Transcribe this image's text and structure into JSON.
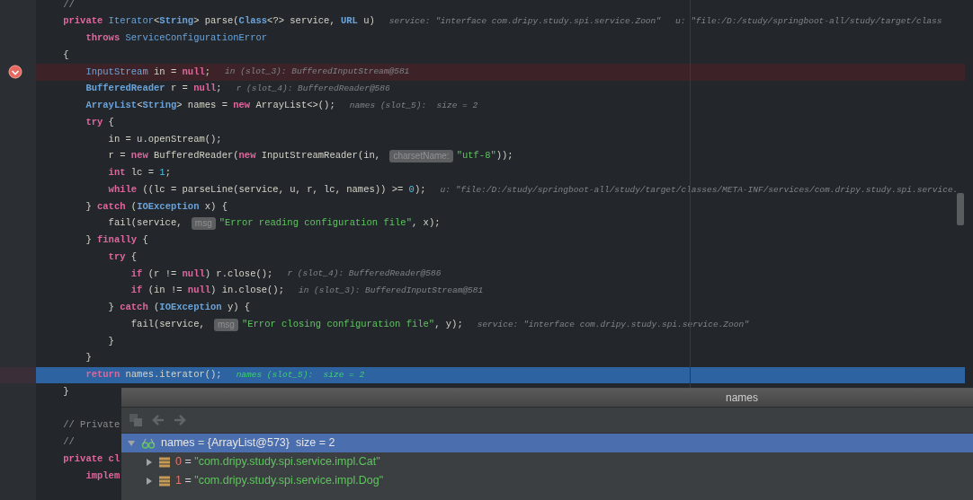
{
  "editor": {
    "lines": [
      {
        "breakpoint": false,
        "current": false,
        "tokens": [
          {
            "kind": "comment",
            "text": "    //"
          }
        ]
      },
      {
        "breakpoint": false,
        "current": false,
        "tokens": [
          {
            "kind": "kw",
            "text": "    private"
          },
          {
            "kind": "type_light",
            "text": " Iterator"
          },
          {
            "kind": "plain",
            "text": "<"
          },
          {
            "kind": "type",
            "text": "String"
          },
          {
            "kind": "plain",
            "text": "> parse("
          },
          {
            "kind": "type",
            "text": "Class"
          },
          {
            "kind": "plain",
            "text": "<?> service, "
          },
          {
            "kind": "type",
            "text": "URL"
          },
          {
            "kind": "plain",
            "text": " u)"
          },
          {
            "kind": "hint",
            "text": "service: \"interface com.dripy.study.spi.service.Zoon\""
          },
          {
            "kind": "hint",
            "text": "u: \"file:/D:/study/springboot-all/study/target/class"
          }
        ]
      },
      {
        "breakpoint": false,
        "current": false,
        "tokens": [
          {
            "kind": "kw",
            "text": "        throws"
          },
          {
            "kind": "type_light",
            "text": " ServiceConfigurationError"
          }
        ]
      },
      {
        "breakpoint": false,
        "current": false,
        "tokens": [
          {
            "kind": "plain",
            "text": "    {"
          }
        ]
      },
      {
        "breakpoint": true,
        "current": false,
        "tokens": [
          {
            "kind": "type_light",
            "text": "        InputStream"
          },
          {
            "kind": "plain",
            "text": " in = "
          },
          {
            "kind": "kw",
            "text": "null"
          },
          {
            "kind": "plain",
            "text": ";"
          },
          {
            "kind": "hint",
            "text": "in (slot_3): BufferedInputStream@581"
          }
        ]
      },
      {
        "breakpoint": false,
        "current": false,
        "tokens": [
          {
            "kind": "type",
            "text": "        BufferedReader"
          },
          {
            "kind": "plain",
            "text": " r = "
          },
          {
            "kind": "kw",
            "text": "null"
          },
          {
            "kind": "plain",
            "text": ";"
          },
          {
            "kind": "hint",
            "text": "r (slot_4): BufferedReader@586"
          }
        ]
      },
      {
        "breakpoint": false,
        "current": false,
        "tokens": [
          {
            "kind": "type",
            "text": "        ArrayList"
          },
          {
            "kind": "plain",
            "text": "<"
          },
          {
            "kind": "type",
            "text": "String"
          },
          {
            "kind": "plain",
            "text": "> names = "
          },
          {
            "kind": "kw",
            "text": "new"
          },
          {
            "kind": "plain",
            "text": " ArrayList<>();"
          },
          {
            "kind": "hint",
            "text": "names (slot_5):  size = 2"
          }
        ]
      },
      {
        "breakpoint": false,
        "current": false,
        "tokens": [
          {
            "kind": "kw",
            "text": "        try"
          },
          {
            "kind": "plain",
            "text": " {"
          }
        ]
      },
      {
        "breakpoint": false,
        "current": false,
        "tokens": [
          {
            "kind": "plain",
            "text": "            in = u.openStream();"
          }
        ]
      },
      {
        "breakpoint": false,
        "current": false,
        "tokens": [
          {
            "kind": "plain",
            "text": "            r = "
          },
          {
            "kind": "kw",
            "text": "new"
          },
          {
            "kind": "plain",
            "text": " BufferedReader("
          },
          {
            "kind": "kw",
            "text": "new"
          },
          {
            "kind": "plain",
            "text": " InputStreamReader(in, "
          },
          {
            "kind": "inlay",
            "text": "charsetName:"
          },
          {
            "kind": "str",
            "text": "\"utf-8\""
          },
          {
            "kind": "plain",
            "text": "));"
          }
        ]
      },
      {
        "breakpoint": false,
        "current": false,
        "tokens": [
          {
            "kind": "kw",
            "text": "            int"
          },
          {
            "kind": "plain",
            "text": " lc = "
          },
          {
            "kind": "num",
            "text": "1"
          },
          {
            "kind": "plain",
            "text": ";"
          }
        ]
      },
      {
        "breakpoint": false,
        "current": false,
        "tokens": [
          {
            "kind": "kw",
            "text": "            while"
          },
          {
            "kind": "plain",
            "text": " ((lc = parseLine(service, u, r, lc, names)) >= "
          },
          {
            "kind": "num",
            "text": "0"
          },
          {
            "kind": "plain",
            "text": ");"
          },
          {
            "kind": "hint",
            "text": "u: \"file:/D:/study/springboot-all/study/target/classes/META-INF/services/com.dripy.study.spi.service."
          }
        ]
      },
      {
        "breakpoint": false,
        "current": false,
        "tokens": [
          {
            "kind": "plain",
            "text": "        } "
          },
          {
            "kind": "kw",
            "text": "catch"
          },
          {
            "kind": "plain",
            "text": " ("
          },
          {
            "kind": "type",
            "text": "IOException"
          },
          {
            "kind": "plain",
            "text": " x) {"
          }
        ]
      },
      {
        "breakpoint": false,
        "current": false,
        "tokens": [
          {
            "kind": "plain",
            "text": "            fail(service, "
          },
          {
            "kind": "inlay",
            "text": "msg"
          },
          {
            "kind": "str",
            "text": "\"Error reading configuration file\""
          },
          {
            "kind": "plain",
            "text": ", x);"
          }
        ]
      },
      {
        "breakpoint": false,
        "current": false,
        "tokens": [
          {
            "kind": "plain",
            "text": "        } "
          },
          {
            "kind": "kw",
            "text": "finally"
          },
          {
            "kind": "plain",
            "text": " {"
          }
        ]
      },
      {
        "breakpoint": false,
        "current": false,
        "tokens": [
          {
            "kind": "kw",
            "text": "            try"
          },
          {
            "kind": "plain",
            "text": " {"
          }
        ]
      },
      {
        "breakpoint": false,
        "current": false,
        "tokens": [
          {
            "kind": "kw",
            "text": "                if"
          },
          {
            "kind": "plain",
            "text": " (r != "
          },
          {
            "kind": "kw",
            "text": "null"
          },
          {
            "kind": "plain",
            "text": ") r.close();"
          },
          {
            "kind": "hint",
            "text": "r (slot_4): BufferedReader@586"
          }
        ]
      },
      {
        "breakpoint": false,
        "current": false,
        "tokens": [
          {
            "kind": "kw",
            "text": "                if"
          },
          {
            "kind": "plain",
            "text": " (in != "
          },
          {
            "kind": "kw",
            "text": "null"
          },
          {
            "kind": "plain",
            "text": ") in.close();"
          },
          {
            "kind": "hint",
            "text": "in (slot_3): BufferedInputStream@581"
          }
        ]
      },
      {
        "breakpoint": false,
        "current": false,
        "tokens": [
          {
            "kind": "plain",
            "text": "            } "
          },
          {
            "kind": "kw",
            "text": "catch"
          },
          {
            "kind": "plain",
            "text": " ("
          },
          {
            "kind": "type",
            "text": "IOException"
          },
          {
            "kind": "plain",
            "text": " y) {"
          }
        ]
      },
      {
        "breakpoint": false,
        "current": false,
        "tokens": [
          {
            "kind": "plain",
            "text": "                fail(service, "
          },
          {
            "kind": "inlay",
            "text": "msg"
          },
          {
            "kind": "str",
            "text": "\"Error closing configuration file\""
          },
          {
            "kind": "plain",
            "text": ", y);"
          },
          {
            "kind": "hint",
            "text": "service: \"interface com.dripy.study.spi.service.Zoon\""
          }
        ]
      },
      {
        "breakpoint": false,
        "current": false,
        "tokens": [
          {
            "kind": "plain",
            "text": "            }"
          }
        ]
      },
      {
        "breakpoint": false,
        "current": false,
        "tokens": [
          {
            "kind": "plain",
            "text": "        }"
          }
        ]
      },
      {
        "breakpoint": false,
        "current": true,
        "tokens": [
          {
            "kind": "kw",
            "text": "        return"
          },
          {
            "kind": "plain",
            "text": " names.iterator();"
          },
          {
            "kind": "hint",
            "text": "names (slot_5):  size = 2"
          }
        ]
      },
      {
        "breakpoint": false,
        "current": false,
        "tokens": [
          {
            "kind": "plain",
            "text": "    }"
          }
        ]
      },
      {
        "breakpoint": false,
        "current": false
      },
      {
        "breakpoint": false,
        "current": false,
        "tokens": [
          {
            "kind": "comment",
            "text": "    // Private"
          }
        ]
      },
      {
        "breakpoint": false,
        "current": false,
        "tokens": [
          {
            "kind": "comment",
            "text": "    //"
          }
        ]
      },
      {
        "breakpoint": false,
        "current": false,
        "tokens": [
          {
            "kind": "kw",
            "text": "    private cl"
          }
        ]
      },
      {
        "breakpoint": false,
        "current": false,
        "tokens": [
          {
            "kind": "kw",
            "text": "        implem"
          }
        ]
      }
    ]
  },
  "debug_popup": {
    "title": "names",
    "tree": [
      {
        "name": "names",
        "operator": "=",
        "value": "{ArrayList@573}",
        "extra": "size = 2",
        "expanded": true,
        "selected": true,
        "children": [
          {
            "name": "0",
            "operator": "=",
            "value": "\"com.dripy.study.spi.service.impl.Cat\"",
            "expanded": false,
            "selected": false
          },
          {
            "name": "1",
            "operator": "=",
            "value": "\"com.dripy.study.spi.service.impl.Dog\"",
            "expanded": false,
            "selected": false
          }
        ]
      }
    ]
  }
}
